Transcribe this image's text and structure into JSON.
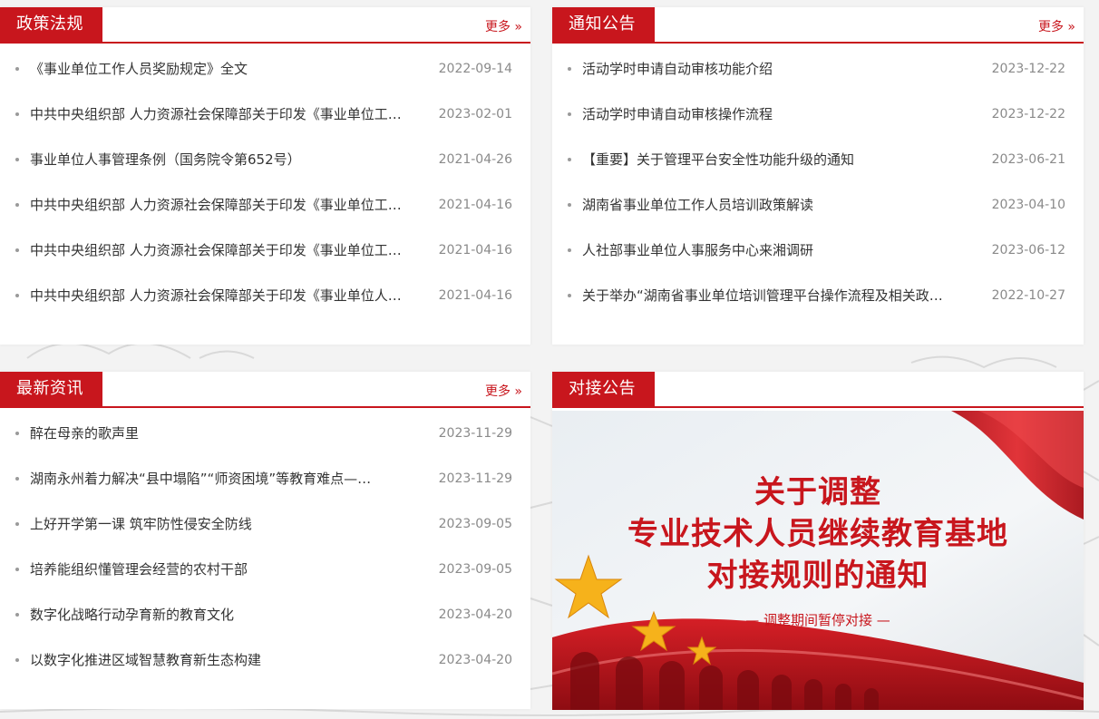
{
  "colors": {
    "accent": "#c8161d",
    "date": "#8a8a8a",
    "text": "#333333"
  },
  "policy": {
    "title": "政策法规",
    "more": "更多 »",
    "items": [
      {
        "title": "《事业单位工作人员奖励规定》全文",
        "date": "2022-09-14"
      },
      {
        "title": "中共中央组织部 人力资源社会保障部关于印发《事业单位工…",
        "date": "2023-02-01"
      },
      {
        "title": "事业单位人事管理条例（国务院令第652号）",
        "date": "2021-04-26"
      },
      {
        "title": "中共中央组织部 人力资源社会保障部关于印发《事业单位工…",
        "date": "2021-04-16"
      },
      {
        "title": "中共中央组织部 人力资源社会保障部关于印发《事业单位工…",
        "date": "2021-04-16"
      },
      {
        "title": "中共中央组织部 人力资源社会保障部关于印发《事业单位人…",
        "date": "2021-04-16"
      }
    ]
  },
  "notice": {
    "title": "通知公告",
    "more": "更多 »",
    "items": [
      {
        "title": "活动学时申请自动审核功能介绍",
        "date": "2023-12-22"
      },
      {
        "title": "活动学时申请自动审核操作流程",
        "date": "2023-12-22"
      },
      {
        "title": "【重要】关于管理平台安全性功能升级的通知",
        "date": "2023-06-21"
      },
      {
        "title": "湖南省事业单位工作人员培训政策解读",
        "date": "2023-04-10"
      },
      {
        "title": "人社部事业单位人事服务中心来湘调研",
        "date": "2023-06-12"
      },
      {
        "title": "关于举办“湖南省事业单位培训管理平台操作流程及相关政…",
        "date": "2022-10-27"
      }
    ]
  },
  "news": {
    "title": "最新资讯",
    "more": "更多 »",
    "items": [
      {
        "title": "醉在母亲的歌声里",
        "date": "2023-11-29"
      },
      {
        "title": "湖南永州着力解决“县中塌陷”“师资困境”等教育难点—…",
        "date": "2023-11-29"
      },
      {
        "title": "上好开学第一课 筑牢防性侵安全防线",
        "date": "2023-09-05"
      },
      {
        "title": "培养能组织懂管理会经营的农村干部",
        "date": "2023-09-05"
      },
      {
        "title": "数字化战略行动孕育新的教育文化",
        "date": "2023-04-20"
      },
      {
        "title": "以数字化推进区域智慧教育新生态构建",
        "date": "2023-04-20"
      }
    ]
  },
  "docking": {
    "title": "对接公告",
    "banner": {
      "line1": "关于调整",
      "line2": "专业技术人员继续教育基地",
      "line3": "对接规则的通知",
      "sub": "— 调整期间暂停对接 —"
    }
  }
}
